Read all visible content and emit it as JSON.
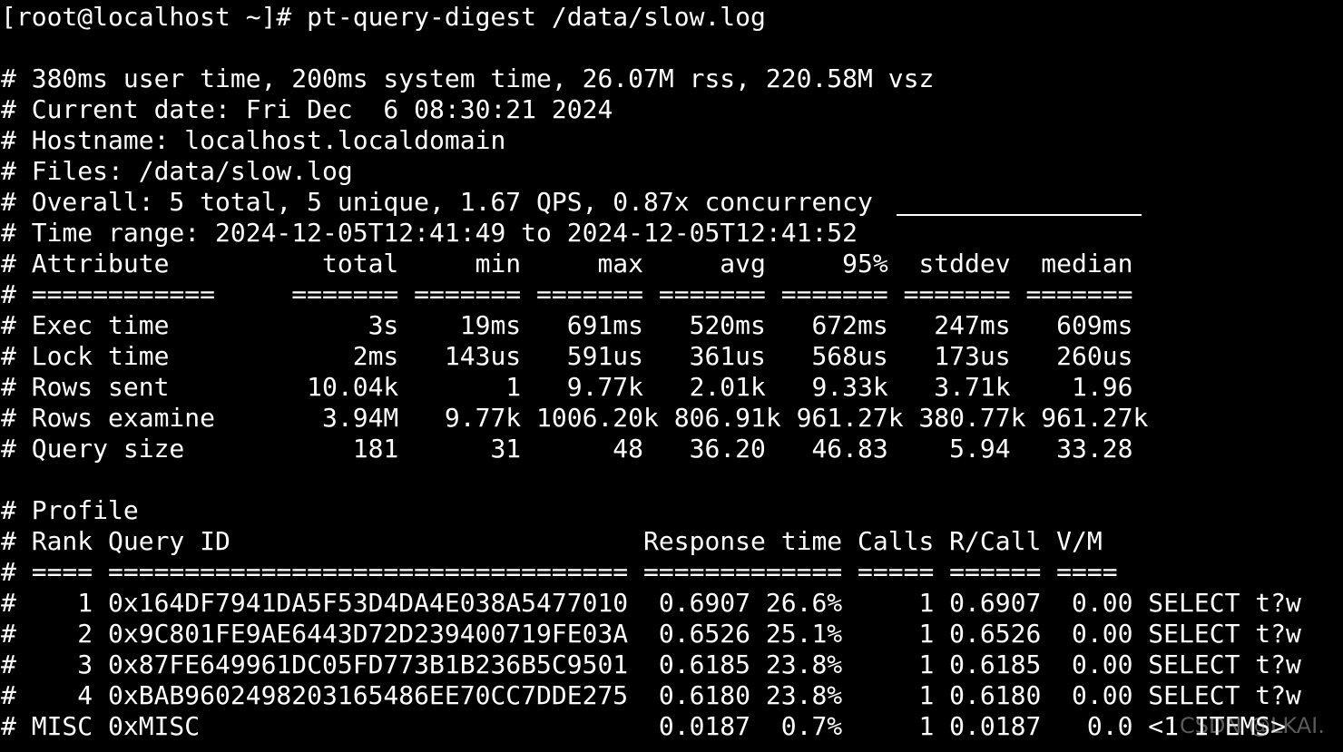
{
  "prompt": "[root@localhost ~]# pt-query-digest /data/slow.log",
  "header": [
    "# 380ms user time, 200ms system time, 26.07M rss, 220.58M vsz",
    "# Current date: Fri Dec  6 08:30:21 2024",
    "# Hostname: localhost.localdomain",
    "# Files: /data/slow.log",
    "# Overall: 5 total, 5 unique, 1.67 QPS, 0.87x concurrency",
    "# Time range: 2024-12-05T12:41:49 to 2024-12-05T12:41:52"
  ],
  "attributes": {
    "header": "# Attribute          total     min     max     avg     95%  stddev  median",
    "separator": "# ============     ======= ======= ======= ======= ======= ======= =======",
    "rows": [
      "# Exec time             3s    19ms   691ms   520ms   672ms   247ms   609ms",
      "# Lock time            2ms   143us   591us   361us   568us   173us   260us",
      "# Rows sent         10.04k       1   9.77k   2.01k   9.33k   3.71k    1.96",
      "# Rows examine       3.94M   9.77k 1006.20k 806.91k 961.27k 380.77k 961.27k",
      "# Query size           181      31      48   36.20   46.83    5.94   33.28"
    ]
  },
  "profile": {
    "title": "# Profile",
    "header": "# Rank Query ID                           Response time Calls R/Call V/M",
    "separator": "# ==== ================================== ============= ===== ====== ====",
    "rows": [
      "#    1 0x164DF7941DA5F53D4DA4E038A5477010  0.6907 26.6%     1 0.6907  0.00 SELECT t?w",
      "#    2 0x9C801FE9AE6443D72D239400719FE03A  0.6526 25.1%     1 0.6526  0.00 SELECT t?w",
      "#    3 0x87FE649961DC05FD773B1B236B5C9501  0.6185 23.8%     1 0.6185  0.00 SELECT t?w",
      "#    4 0xBAB9602498203165486EE70CC7DDE275  0.6180 23.8%     1 0.6180  0.00 SELECT t?w",
      "# MISC 0xMISC                              0.0187  0.7%     1 0.0187   0.0 <1 ITEMS>"
    ]
  },
  "watermark": "CSDN @LKAI."
}
